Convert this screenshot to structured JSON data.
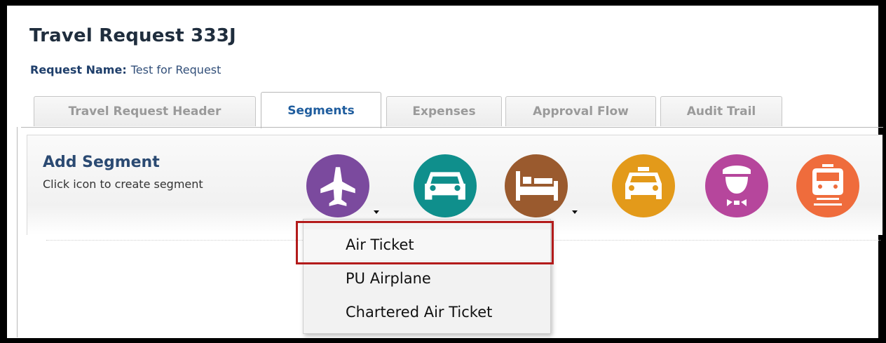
{
  "page": {
    "title": "Travel Request 333J",
    "request_name_label": "Request Name:",
    "request_name_value": "Test for Request"
  },
  "tabs": [
    {
      "label": "Travel Request Header",
      "active": false
    },
    {
      "label": "Segments",
      "active": true
    },
    {
      "label": "Expenses",
      "active": false
    },
    {
      "label": "Approval Flow",
      "active": false
    },
    {
      "label": "Audit Trail",
      "active": false
    }
  ],
  "segments": {
    "title": "Add Segment",
    "subtitle": "Click icon to create segment",
    "icons": [
      {
        "name": "airplane-icon",
        "color": "#7b4a9e",
        "has_dropdown": true
      },
      {
        "name": "car-icon",
        "color": "#0f8f8c",
        "has_dropdown": false
      },
      {
        "name": "bed-icon",
        "color": "#9a5a2e",
        "has_dropdown": true
      },
      {
        "name": "taxi-icon",
        "color": "#e39a1a",
        "has_dropdown": false
      },
      {
        "name": "chauffeur-icon",
        "color": "#b6469c",
        "has_dropdown": false
      },
      {
        "name": "train-icon",
        "color": "#ef6c3c",
        "has_dropdown": false
      }
    ]
  },
  "dropdown": {
    "items": [
      "Air Ticket",
      "PU Airplane",
      "Chartered Air Ticket"
    ],
    "highlight_color": "#b31b1b"
  }
}
